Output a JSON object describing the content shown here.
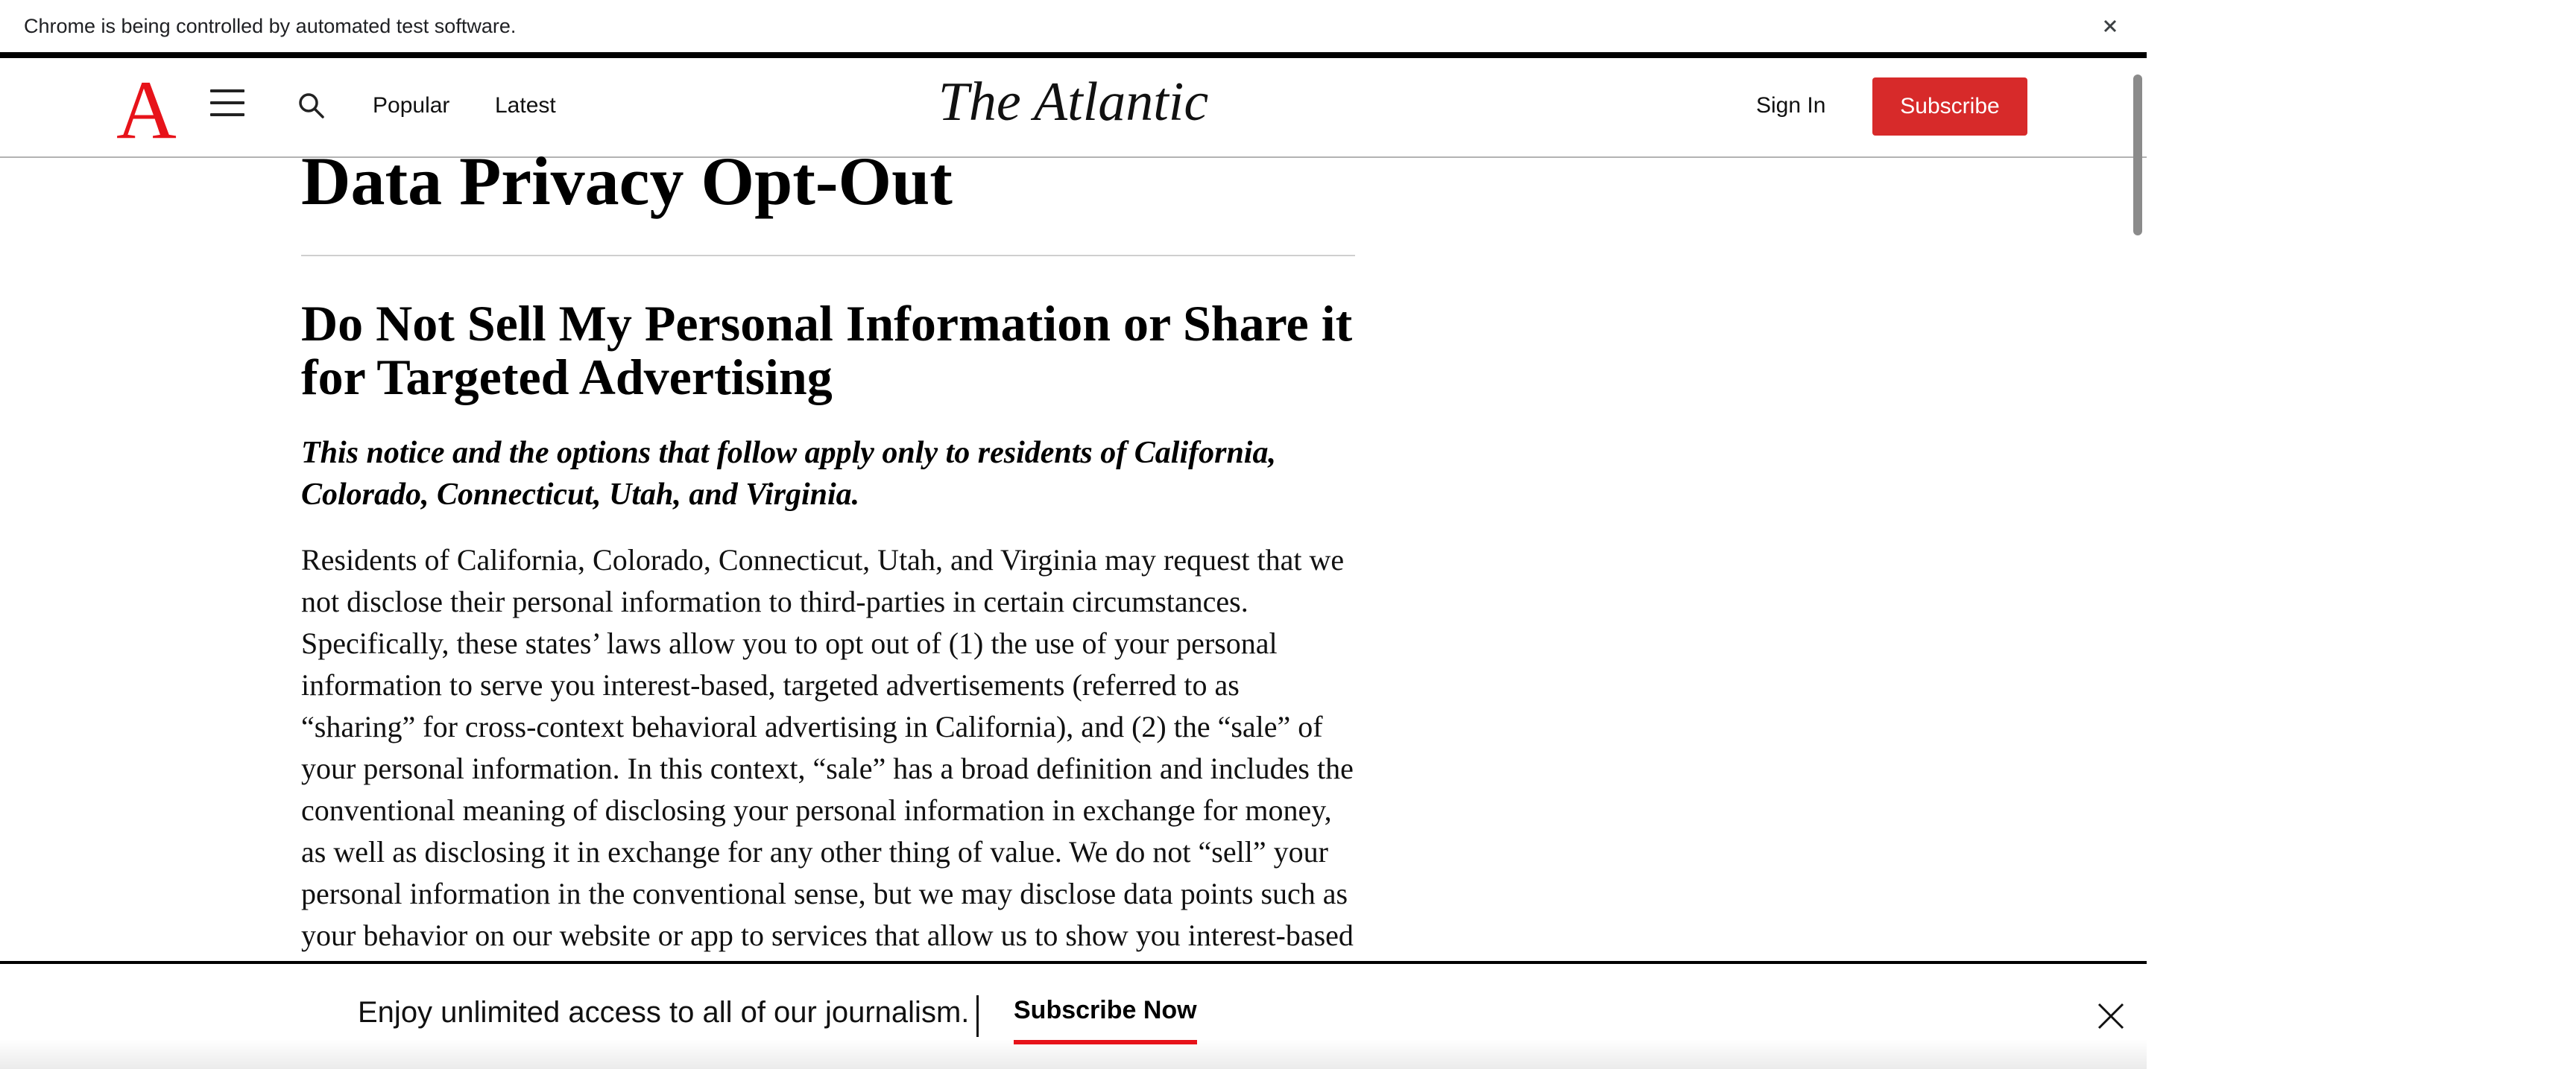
{
  "browser": {
    "infobar_text": "Chrome is being controlled by automated test software."
  },
  "header": {
    "logo_letter": "A",
    "nav": [
      "Popular",
      "Latest"
    ],
    "wordmark": "The Atlantic",
    "sign_in": "Sign In",
    "subscribe": "Subscribe"
  },
  "article": {
    "title": "Data Privacy Opt-Out",
    "section_heading": "Do Not Sell My Personal Information or Share it for Targeted Advertising",
    "notice": "This notice and the options that follow apply only to residents of California, Colorado, Connecticut, Utah, and Virginia.",
    "body": "Residents of California, Colorado, Connecticut, Utah, and Virginia may request that we not disclose their personal information to third-parties in certain circumstances.  Specifically, these states’ laws allow you to opt out of (1) the use of your personal information to serve you interest-based, targeted advertisements (referred to as “sharing” for cross-context behavioral advertising in California), and (2) the “sale” of your personal information. In this context, “sale” has a broad definition and includes the conventional meaning of disclosing your personal information in exchange for money, as well as disclosing it in exchange for any other thing of value.  We do not “sell” your personal information in the conventional sense, but we may disclose data points such as your behavior on our website or app to services that allow us to show you interest-based"
  },
  "banner": {
    "text": "Enjoy unlimited access to all of our journalism.",
    "cta": "Subscribe Now"
  },
  "colors": {
    "brand_red": "#e7131a",
    "subscribe_button": "#d72a2a"
  },
  "icons": [
    "close-icon",
    "menu-icon",
    "search-icon"
  ]
}
